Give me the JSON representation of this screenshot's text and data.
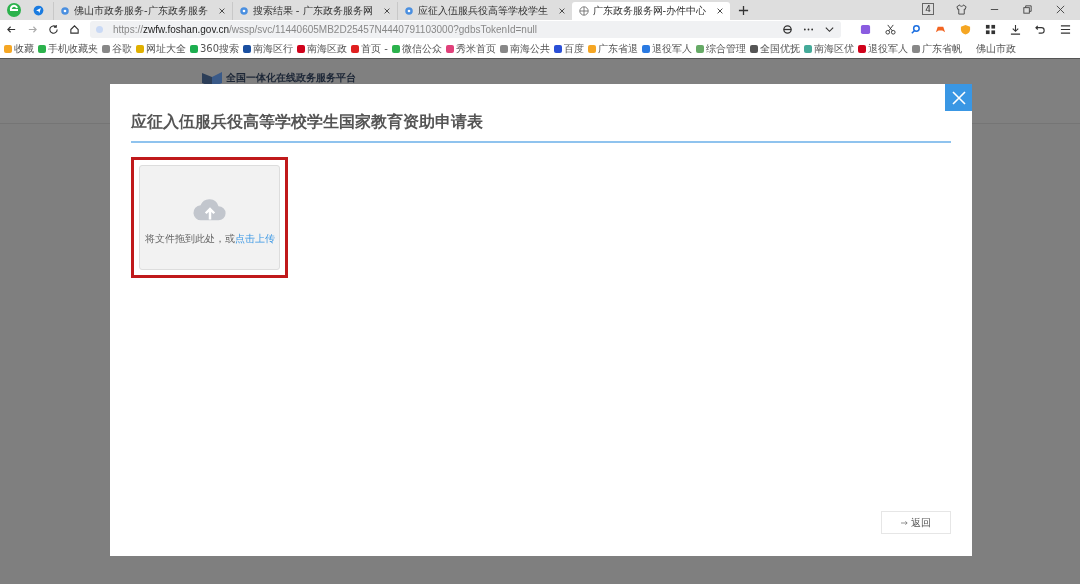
{
  "browser": {
    "tabs": [
      {
        "title": "佛山市政务服务-广东政务服务",
        "selected": false
      },
      {
        "title": "搜索结果 - 广东政务服务网",
        "selected": false
      },
      {
        "title": "应征入伍服兵役高等学校学生",
        "selected": false
      },
      {
        "title": "广东政务服务网-办件中心",
        "selected": true
      }
    ],
    "tab_count": "4",
    "address": "https://**zwfw.foshan.gov.cn**/wssp/svc/11440605MB2D25457N4440791103000?gdbsTokenId=null",
    "bookmarks": [
      "收藏",
      "手机收藏夹",
      "谷歌",
      "网址大全",
      "360搜索",
      "南海区行",
      "南海区政",
      "首页 -",
      "微信公众",
      "秀米首页",
      "南海公共",
      "百度",
      "广东省退",
      "退役军人",
      "综合管理",
      "全国优抚",
      "南海区优",
      "退役军人",
      "广东省帆",
      "佛山市政"
    ]
  },
  "page": {
    "platform_name": "全国一体化在线政务服务平台"
  },
  "dialog": {
    "title": "应征入伍服兵役高等学校学生国家教育资助申请表",
    "upload": {
      "hint": "将文件拖到此处，或",
      "link": "点击上传",
      "highlighted": true
    },
    "back_button": "返回"
  }
}
